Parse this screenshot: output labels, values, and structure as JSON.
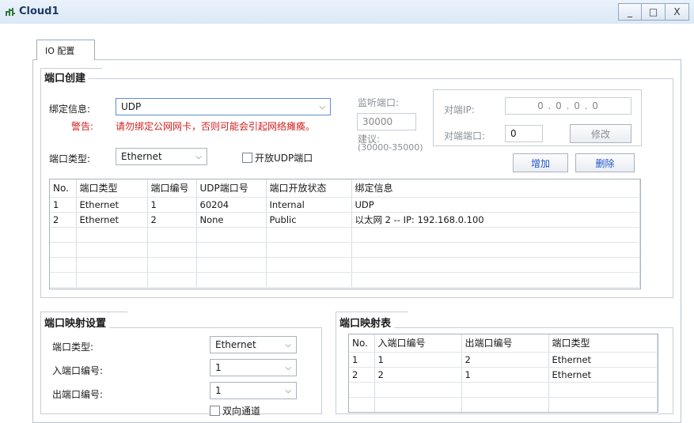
{
  "window": {
    "title": "Cloud1",
    "minimize_glyph": "_",
    "maximize_glyph": "□",
    "close_glyph": "X",
    "icon": "cloud-network-icon"
  },
  "tabs": [
    {
      "label": "IO 配置"
    }
  ],
  "port_create": {
    "title": "端口创建",
    "bind_label": "绑定信息:",
    "bind_value": "UDP",
    "warning_label": "警告:",
    "warning_text": "请勿绑定公网网卡，否则可能会引起网络瘫痪。",
    "port_type_label": "端口类型:",
    "port_type_value": "Ethernet",
    "open_udp_label": "开放UDP端口",
    "listen_port_label": "监听端口:",
    "listen_port_value": "30000",
    "suggest_label": "建议:",
    "suggest_range": "(30000-35000)",
    "remote_ip_label": "对端IP:",
    "remote_ip_value": "0 . 0 . 0 . 0",
    "remote_port_label": "对端端口:",
    "remote_port_value": "0",
    "modify_button": "修改",
    "add_button": "增加",
    "delete_button": "删除",
    "table": {
      "headers": [
        "No.",
        "端口类型",
        "端口编号",
        "UDP端口号",
        "端口开放状态",
        "绑定信息"
      ],
      "rows": [
        [
          "1",
          "Ethernet",
          "1",
          "60204",
          "Internal",
          "UDP"
        ],
        [
          "2",
          "Ethernet",
          "2",
          "None",
          "Public",
          "以太网 2 -- IP: 192.168.0.100"
        ]
      ]
    }
  },
  "port_map_settings": {
    "title": "端口映射设置",
    "port_type_label": "端口类型:",
    "port_type_value": "Ethernet",
    "in_port_label": "入端口编号:",
    "in_port_value": "1",
    "out_port_label": "出端口编号:",
    "out_port_value": "1",
    "bidirectional_label": "双向通道"
  },
  "port_map_table": {
    "title": "端口映射表",
    "headers": [
      "No.",
      "入端口编号",
      "出端口编号",
      "端口类型"
    ],
    "rows": [
      [
        "1",
        "1",
        "2",
        "Ethernet"
      ],
      [
        "2",
        "2",
        "1",
        "Ethernet"
      ]
    ]
  }
}
